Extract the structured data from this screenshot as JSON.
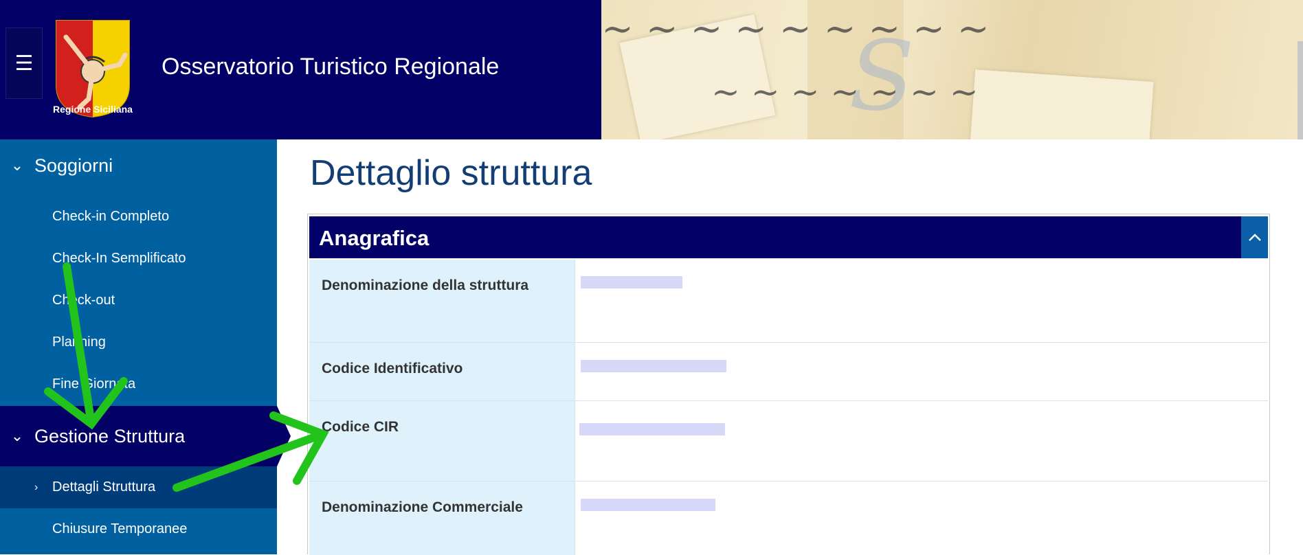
{
  "header": {
    "menu_icon": "hamburger-icon",
    "logo_caption": "Regione Siciliana",
    "site_title": "Osservatorio Turistico Regionale"
  },
  "sidebar": {
    "sections": [
      {
        "label": "Soggiorni",
        "expanded": true,
        "items": [
          "Check-in Completo",
          "Check-In Semplificato",
          "Check-out",
          "Planning",
          "Fine Giornata"
        ]
      },
      {
        "label": "Gestione Struttura",
        "expanded": true,
        "active": true,
        "items": [
          "Dettagli Struttura",
          "Chiusure Temporanee"
        ],
        "active_item": "Dettagli Struttura"
      }
    ]
  },
  "main": {
    "page_title": "Dettaglio struttura",
    "panel": {
      "title": "Anagrafica",
      "toggle_icon": "chevron-up-icon",
      "rows": [
        {
          "label": "Denominazione della struttura"
        },
        {
          "label": "Codice Identificativo"
        },
        {
          "label": "Codice CIR"
        },
        {
          "label": "Denominazione Commerciale"
        }
      ]
    }
  },
  "colors": {
    "header_bg": "#020066",
    "sidebar_bg": "#0060a0",
    "sidebar_active_bg": "#030066",
    "label_bg": "#dff2fc",
    "title_color": "#123e75",
    "annotation_arrow": "#22c41c"
  }
}
